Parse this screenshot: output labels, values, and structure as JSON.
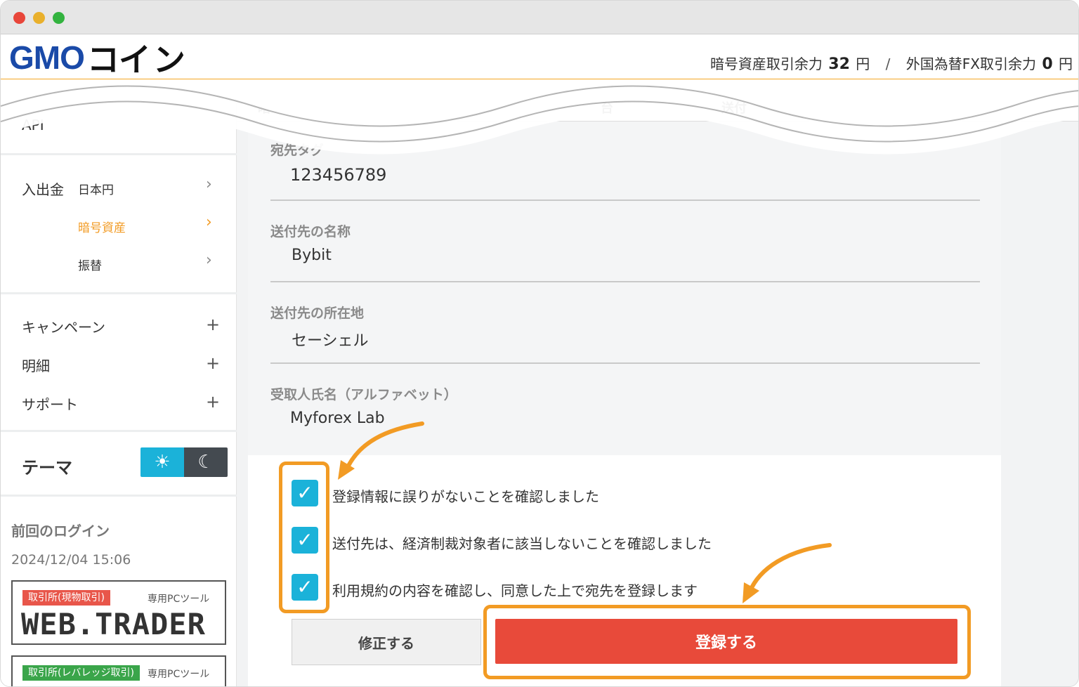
{
  "header": {
    "logo_main": "GMO",
    "logo_sub": "コイ",
    "logo_tail": "ン",
    "crypto_label": "暗号資産取引余力",
    "crypto_value": "32",
    "crypto_unit": "円",
    "separator": "/",
    "fx_label": "外国為替FX取引余力",
    "fx_value": "0",
    "fx_unit": "円"
  },
  "sidebar": {
    "api_label": "API",
    "deposit_label": "入出金",
    "sub_items": [
      "日本円",
      "暗号資産",
      "振替"
    ],
    "active_sub_item": "暗号資産",
    "sections": [
      "キャンペーン",
      "明細",
      "サポート"
    ],
    "theme_label": "テーマ",
    "last_login_label": "前回のログイン",
    "last_login_time": "2024/12/04 15:06",
    "banner1": {
      "tag": "取引所(現物取引)",
      "pc": "専用PCツール",
      "title": "WEB.TRADER"
    },
    "banner2": {
      "tag": "取引所(レバレッジ取引)",
      "pc": "専用PCツール"
    }
  },
  "form": {
    "fields": [
      {
        "label": "宛先タグ",
        "value": "123456789"
      },
      {
        "label": "送付先の名称",
        "value": "Bybit"
      },
      {
        "label": "送付先の所在地",
        "value": "セーシェル"
      },
      {
        "label": "受取人氏名（アルファベット）",
        "value": "Myforex Lab"
      }
    ],
    "checks": [
      "登録情報に誤りがないことを確認しました",
      "送付先は、経済制裁対象者に該当しないことを確認しました",
      "利用規約の内容を確認し、同意した上で宛先を登録します"
    ],
    "fix_button": "修正する",
    "register_button": "登録する"
  },
  "colors": {
    "accent_orange": "#f29b24",
    "checkbox_blue": "#1bb2d9",
    "register_red": "#e84a3a"
  }
}
